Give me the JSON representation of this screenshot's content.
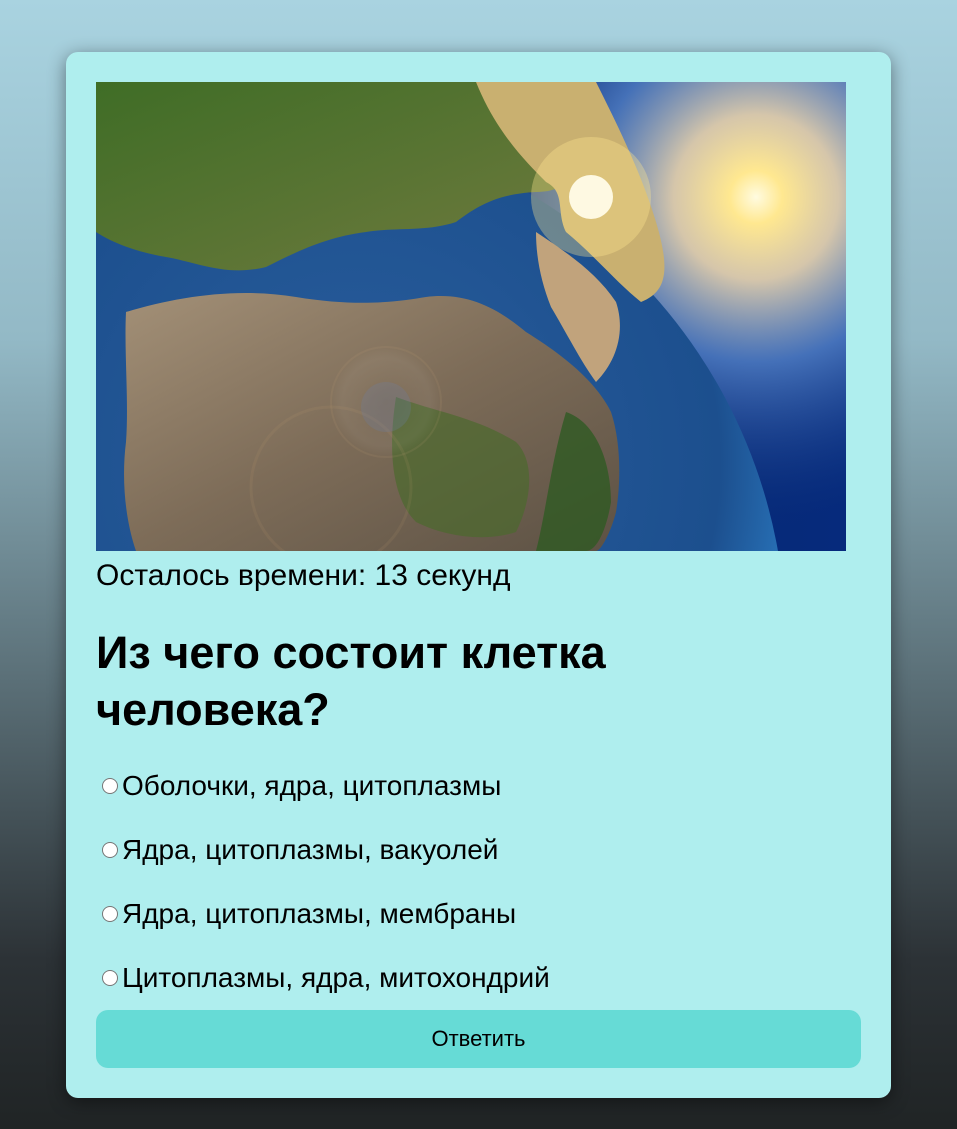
{
  "quiz": {
    "image": {
      "subject": "earth-from-space-sunrise",
      "colors": {
        "space": "#0a2f7a",
        "ocean": "#1e6fbf",
        "land": "#8a7a62",
        "vegetation": "#3d6a22",
        "sun": "#fff6b0"
      }
    },
    "timer_text": "Осталось времени: 13 секунд",
    "question": "Из чего состоит клетка человека?",
    "options": [
      {
        "label": "Оболочки, ядра, цитоплазмы",
        "selected": false
      },
      {
        "label": "Ядра, цитоплазмы, вакуолей",
        "selected": false
      },
      {
        "label": "Ядра, цитоплазмы, мембраны",
        "selected": false
      },
      {
        "label": "Цитоплазмы, ядра, митохондрий",
        "selected": false
      }
    ],
    "submit_label": "Ответить"
  },
  "colors": {
    "card_background": "#afeeee",
    "button_background": "#66dbd6"
  }
}
